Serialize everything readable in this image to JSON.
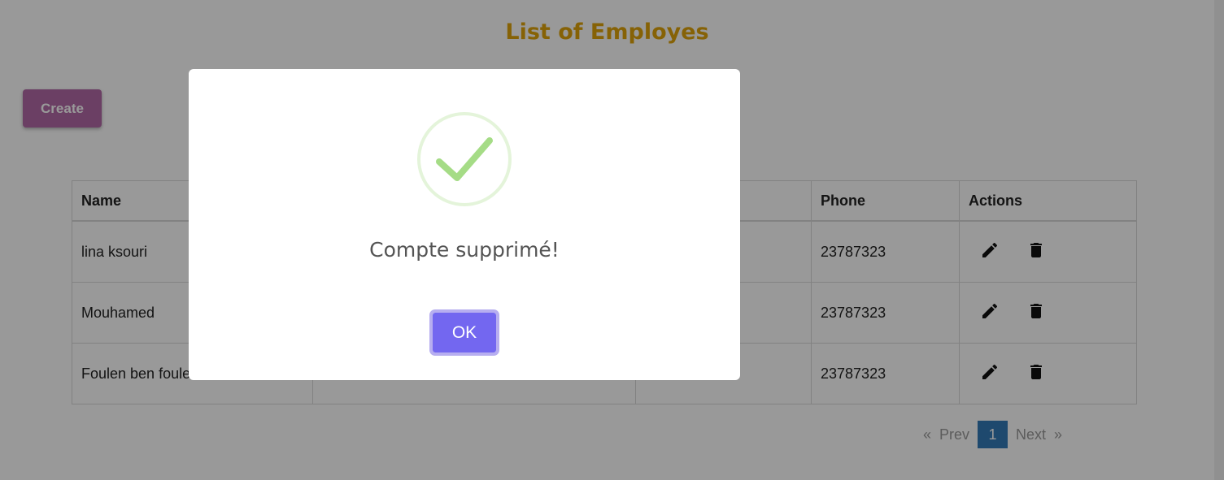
{
  "page": {
    "title": "List of Employes",
    "create_label": "Create"
  },
  "table": {
    "headers": {
      "name": "Name",
      "email": "",
      "role": "",
      "phone": "Phone",
      "actions": "Actions"
    },
    "rows": [
      {
        "name": "lina ksouri",
        "email": "",
        "role": "",
        "phone": "23787323"
      },
      {
        "name": "Mouhamed",
        "email": "",
        "role": "",
        "phone": "23787323"
      },
      {
        "name": "Foulen ben foulen",
        "email": "",
        "role": "",
        "phone": "23787323"
      }
    ],
    "action_icons": [
      "pencil-icon",
      "trash-icon"
    ]
  },
  "pagination": {
    "first": "«",
    "prev": "Prev",
    "current": "1",
    "next": "Next",
    "last": "»"
  },
  "modal": {
    "message": "Compte supprimé!",
    "ok_label": "OK",
    "icon": "success-check-icon"
  },
  "colors": {
    "title": "#e0a40b",
    "create_button": "#b36aa7",
    "ok_button": "#7367f0",
    "pagination_active": "#337ab7",
    "success_check": "#a5dc86"
  }
}
